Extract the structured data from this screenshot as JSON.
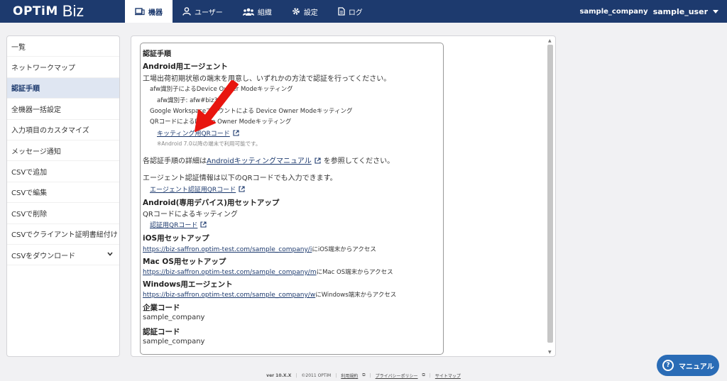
{
  "header": {
    "logo_optim": "OPTiM",
    "logo_biz": "Biz",
    "nav": [
      {
        "label": "機器",
        "icon": "device-icon"
      },
      {
        "label": "ユーザー",
        "icon": "user-icon"
      },
      {
        "label": "組織",
        "icon": "organization-icon"
      },
      {
        "label": "設定",
        "icon": "gear-icon"
      },
      {
        "label": "ログ",
        "icon": "log-icon"
      }
    ],
    "company": "sample_company",
    "username": "sample_user"
  },
  "sidebar": {
    "items": [
      "一覧",
      "ネットワークマップ",
      "認証手順",
      "全機器一括設定",
      "入力項目のカスタマイズ",
      "メッセージ通知",
      "CSVで追加",
      "CSVで編集",
      "CSVで削除",
      "CSVでクライアント証明書紐付け",
      "CSVをダウンロード"
    ],
    "active_index": 2
  },
  "content": {
    "card_title": "認証手順",
    "android": {
      "title": "Android用エージェント",
      "desc": "工場出荷初期状態の端末を用意し、いずれかの方法で認証を行ってください。",
      "m1": "afw識別子によるDevice Owner Modeキッティング",
      "m1_sub": "afw識別子: afw#biz3",
      "m2": "Google Workspaceアカウントによる Device Owner Modeキッティング",
      "m3": "QRコードによるDevice Owner Modeキッティング",
      "qr_link": "キッティング用QRコード",
      "note": "※Android 7.0以降の端末で利用可能です。",
      "detail_pre": "各認証手順の詳細は",
      "detail_link": "Androidキッティングマニュアル",
      "detail_post": "を参照してください。",
      "agent_desc": "エージェント認証情報は以下のQRコードでも入力できます。",
      "agent_link": "エージェント認証用QRコード"
    },
    "dedicated": {
      "title": "Android(専用デバイス)用セットアップ",
      "desc": "QRコードによるキッティング",
      "link": "認証用QRコード"
    },
    "ios": {
      "title": "iOS用セットアップ",
      "url": "https://biz-saffron.optim-test.com/sample_company/i",
      "suffix": "にiOS端末からアクセス"
    },
    "mac": {
      "title": "Mac OS用セットアップ",
      "url": "https://biz-saffron.optim-test.com/sample_company/m",
      "suffix": "にMac OS端末からアクセス"
    },
    "windows": {
      "title": "Windows用エージェント",
      "url": "https://biz-saffron.optim-test.com/sample_company/w",
      "suffix": "にWindows端末からアクセス"
    },
    "company_code": {
      "title": "企業コード",
      "value": "sample_company"
    },
    "auth_code": {
      "title": "認証コード",
      "value": "sample_company"
    }
  },
  "footer": {
    "version": "ver 10.X.X",
    "copyright": "©2011 OPTiM",
    "terms": "利用規約",
    "privacy": "プライバシーポリシー",
    "sitemap": "サイトマップ"
  },
  "manual_button": {
    "label": "マニュアル"
  },
  "colors": {
    "header": "#1d3a6e",
    "link": "#1d3a6e",
    "annotation": "#e8150f",
    "manual": "#2a6cb6"
  }
}
